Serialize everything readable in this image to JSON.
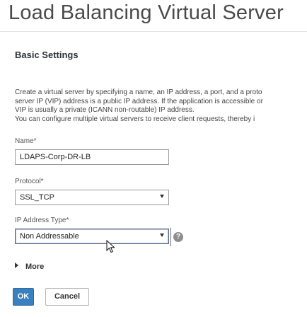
{
  "page": {
    "title": "Load Balancing Virtual Server"
  },
  "basic_settings": {
    "heading": "Basic Settings",
    "description_lines": [
      "Create a virtual server by specifying a name, an IP address, a port, and a proto",
      "server IP (VIP) address is a public IP address. If the application is accessible or",
      "VIP is usually a private (ICANN non-routable) IP address.",
      "You can configure multiple virtual servers to receive client requests, thereby i"
    ]
  },
  "form": {
    "name": {
      "label": "Name*",
      "value": "LDAPS-Corp-DR-LB"
    },
    "protocol": {
      "label": "Protocol*",
      "value": "SSL_TCP"
    },
    "ip_address_type": {
      "label": "IP Address Type*",
      "value": "Non Addressable"
    },
    "help_icon_glyph": "?"
  },
  "more": {
    "label": "More"
  },
  "buttons": {
    "ok": "OK",
    "cancel": "Cancel"
  },
  "colors": {
    "ok_button": "#3a80bf",
    "title": "#4a4a4a"
  },
  "icons": [
    "help-icon",
    "expand-triangle-icon",
    "dropdown-caret-icon",
    "mouse-pointer-icon"
  ]
}
